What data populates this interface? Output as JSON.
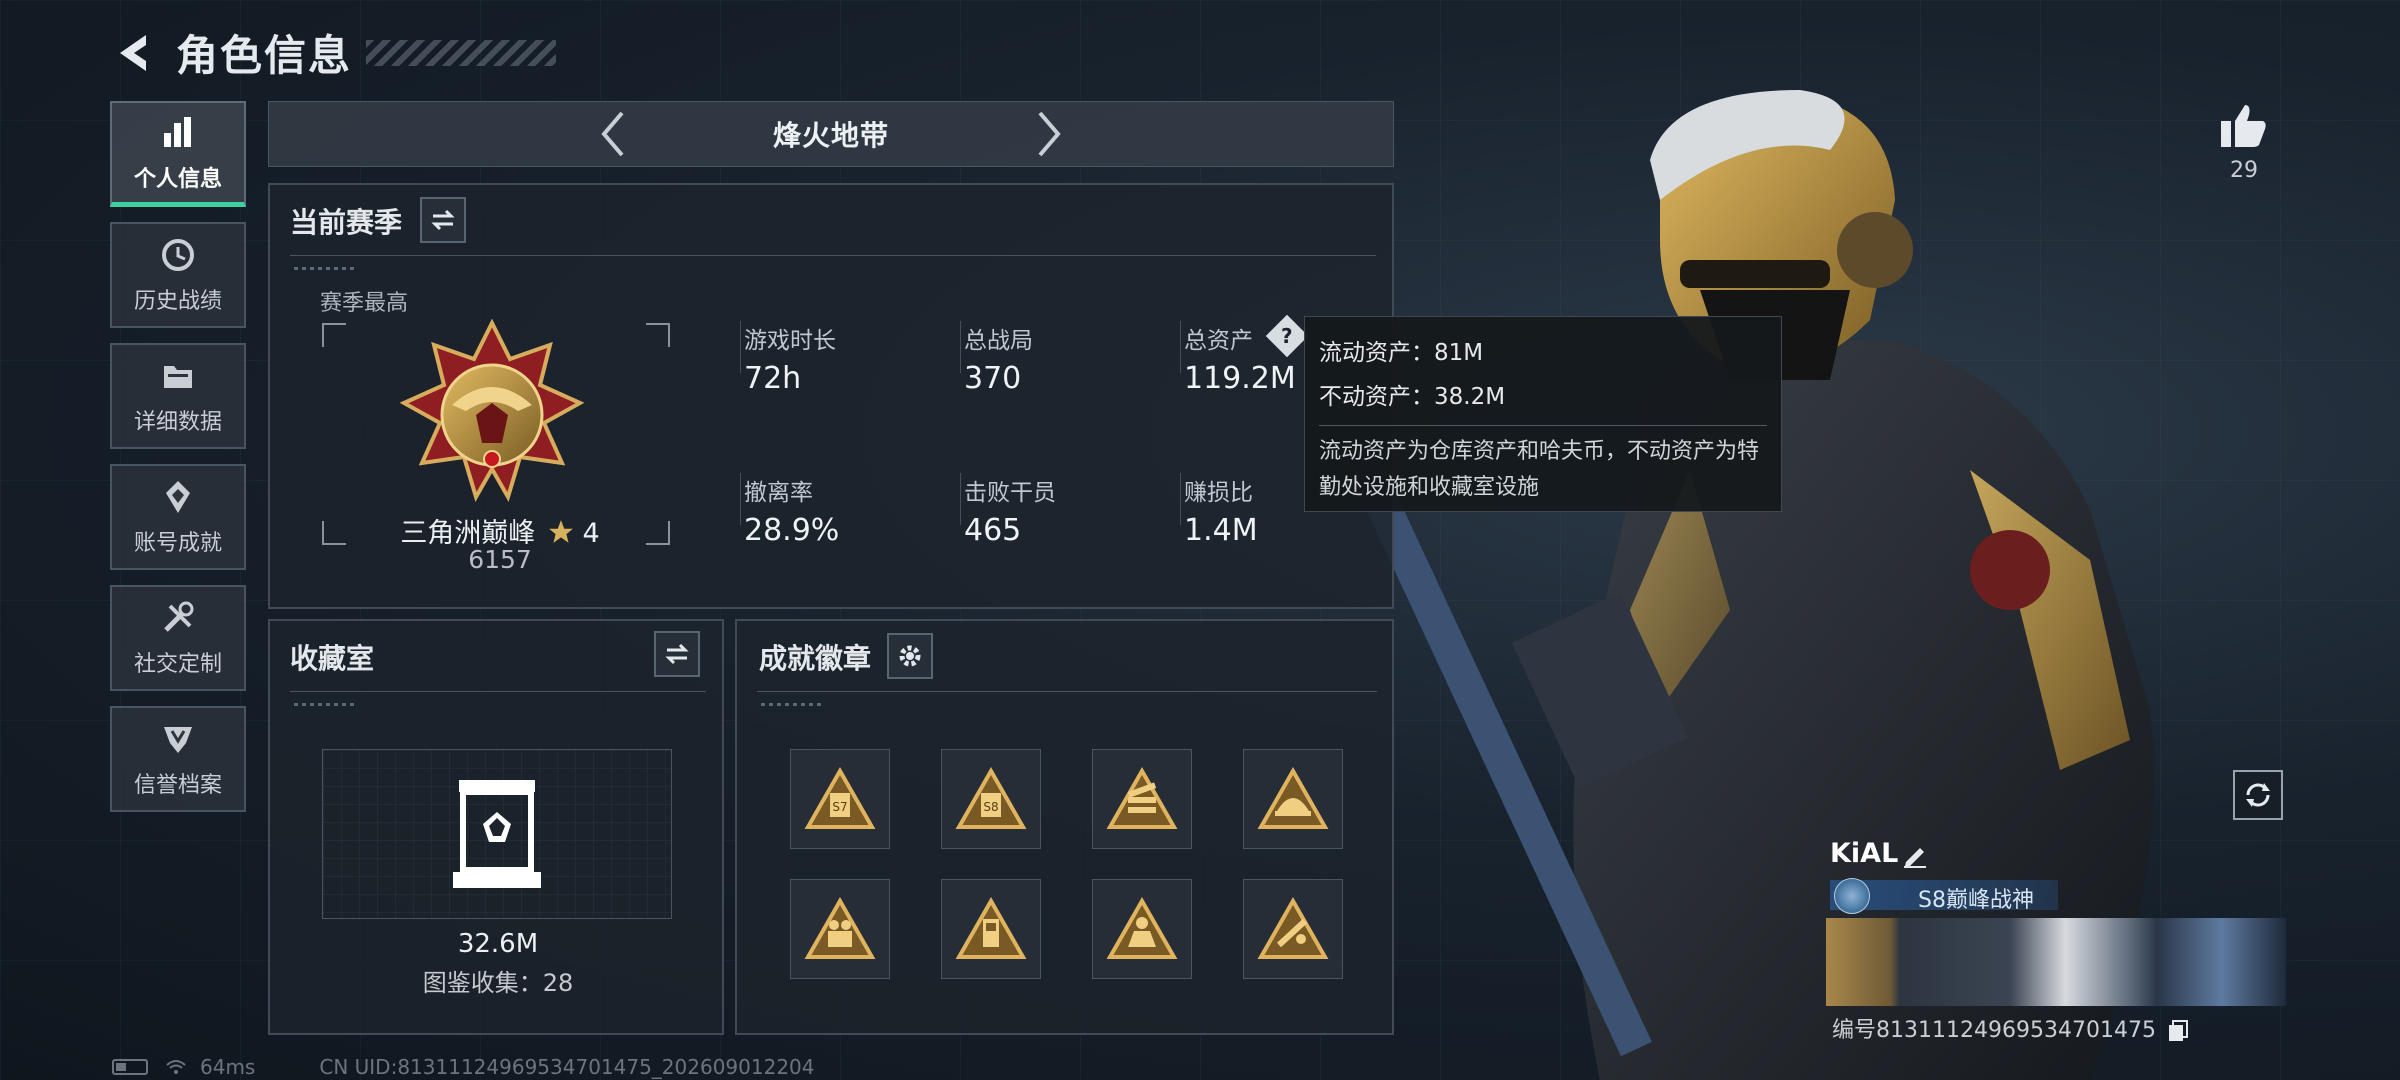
{
  "header": {
    "title": "角色信息"
  },
  "sidebar": {
    "items": [
      {
        "label": "个人信息",
        "icon": "bar-chart-icon",
        "active": true
      },
      {
        "label": "历史战绩",
        "icon": "clock-icon"
      },
      {
        "label": "详细数据",
        "icon": "folder-icon"
      },
      {
        "label": "账号成就",
        "icon": "achievement-icon"
      },
      {
        "label": "社交定制",
        "icon": "tools-icon"
      },
      {
        "label": "信誉档案",
        "icon": "shield-icon"
      }
    ]
  },
  "mode": {
    "title": "烽火地带"
  },
  "season": {
    "title": "当前赛季",
    "subtitle": "赛季最高",
    "rank_name": "三角洲巅峰",
    "rank_stars": "4",
    "rank_score": "6157",
    "stats": [
      {
        "label": "游戏时长",
        "value": "72h"
      },
      {
        "label": "总战局",
        "value": "370"
      },
      {
        "label": "总资产",
        "value": "119.2M"
      },
      {
        "label": "撤离率",
        "value": "28.9%"
      },
      {
        "label": "击败干员",
        "value": "465"
      },
      {
        "label": "赚损比",
        "value": "1.4M"
      }
    ]
  },
  "tooltip": {
    "liquid": "流动资产：81M",
    "fixed": "不动资产：38.2M",
    "desc": "流动资产为仓库资产和哈夫币，不动资产为特勤处设施和收藏室设施"
  },
  "collection": {
    "title": "收藏室",
    "value": "32.6M",
    "count": "图鉴收集：28"
  },
  "badges": {
    "title": "成就徽章",
    "items": 8
  },
  "likes": {
    "count": "29"
  },
  "player": {
    "name": "KiAL",
    "title": "S8巅峰战神",
    "uid": "编号8131112496953470​1475"
  },
  "status": {
    "ping": "64ms",
    "uid_line": "CN UID:81311124969534701475_202609012204"
  },
  "colors": {
    "accent": "#3fd0a0",
    "gold": "#c9a257",
    "panel": "#1c232c"
  }
}
